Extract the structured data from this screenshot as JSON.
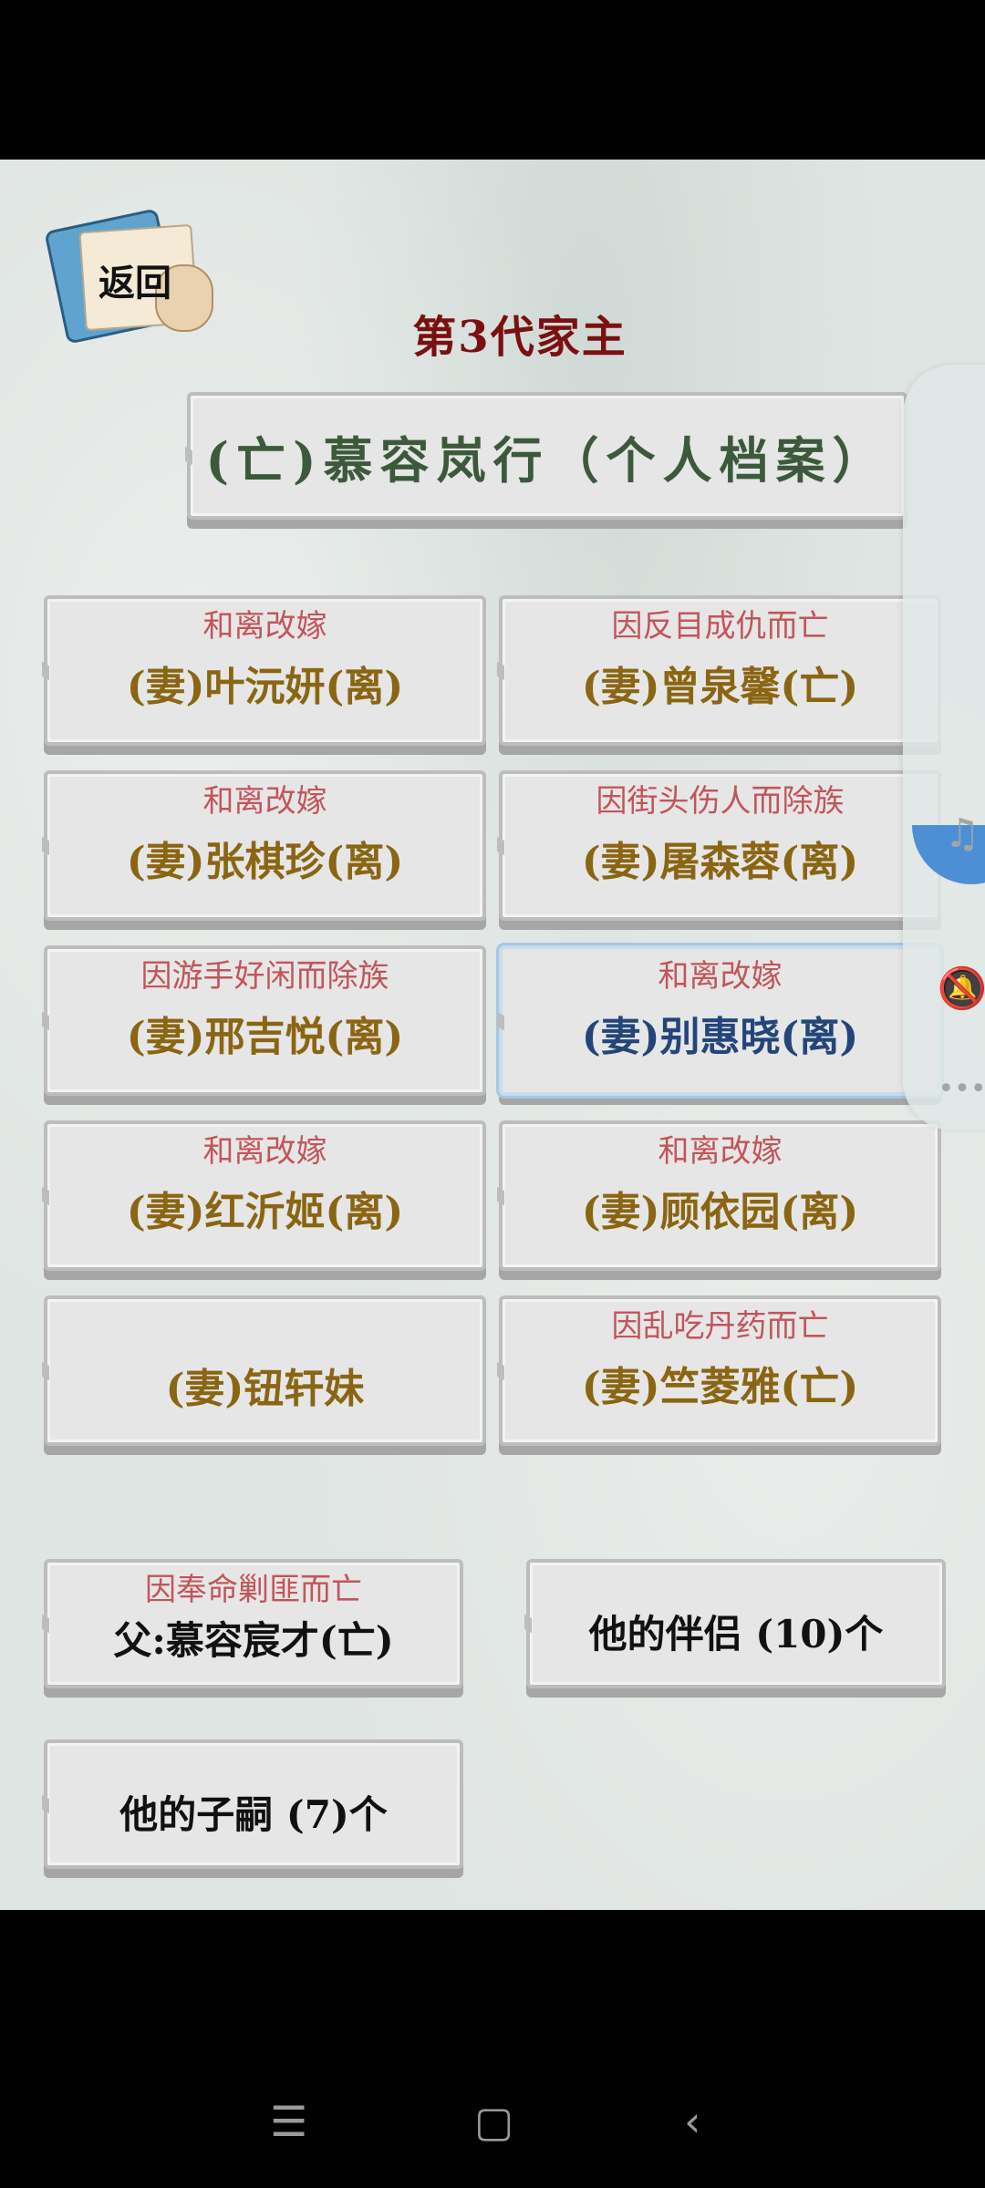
{
  "header": {
    "back_label": "返回",
    "generation_title": "第3代家主",
    "profile_button": "(亡)慕容岚行（个人档案）"
  },
  "spouses": [
    {
      "note": "和离改嫁",
      "name": "(妻)叶沅妍(离)"
    },
    {
      "note": "因反目成仇而亡",
      "name": "(妻)曾泉馨(亡)"
    },
    {
      "note": "和离改嫁",
      "name": "(妻)张棋珍(离)"
    },
    {
      "note": "因街头伤人而除族",
      "name": "(妻)屠森蓉(离)"
    },
    {
      "note": "因游手好闲而除族",
      "name": "(妻)邢吉悦(离)"
    },
    {
      "note": "和离改嫁",
      "name": "(妻)别惠晓(离)",
      "selected": true
    },
    {
      "note": "和离改嫁",
      "name": "(妻)红沂姬(离)"
    },
    {
      "note": "和离改嫁",
      "name": "(妻)顾依园(离)"
    },
    {
      "note": "",
      "name": "(妻)钮轩妹"
    },
    {
      "note": "因乱吃丹药而亡",
      "name": "(妻)竺菱雅(亡)"
    }
  ],
  "relations": {
    "father_note": "因奉命剿匪而亡",
    "father_label": "父:慕容宸才(亡)",
    "partners_label": "他的伴侣 (10)个",
    "children_label": "他的子嗣 (7)个"
  },
  "side_panel": {
    "icons": [
      "music-note-icon",
      "bell-mute-icon",
      "more-dots-icon"
    ]
  },
  "nav": {
    "icons": [
      "menu-icon",
      "home-icon",
      "back-icon"
    ]
  },
  "colors": {
    "title": "#7a1010",
    "profile_text": "#3c5a3b",
    "note_text": "#c2555a",
    "name_text": "#8a6512",
    "selected_name": "#24457a"
  }
}
